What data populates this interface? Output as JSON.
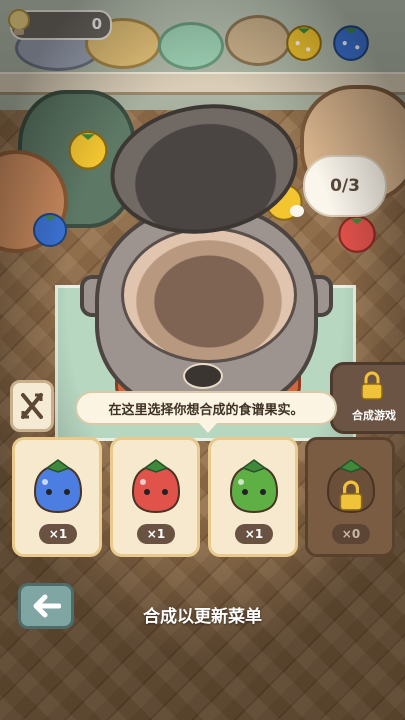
{
  "hud": {
    "coins": "0"
  },
  "recipe_progress": "0/3",
  "tooltip": "在这里选择你想合成的食谱果实。",
  "play_button": {
    "label": "合成游戏"
  },
  "cards": [
    {
      "fruit": "blue",
      "color": "#4c7de0",
      "quantity": "×1",
      "locked": false
    },
    {
      "fruit": "red",
      "color": "#e1524b",
      "quantity": "×1",
      "locked": false
    },
    {
      "fruit": "green",
      "color": "#5fb044",
      "quantity": "×1",
      "locked": false
    },
    {
      "fruit": "locked",
      "color": "#6b4f39",
      "quantity": "×0",
      "locked": true
    }
  ],
  "hint": "合成以更新菜单",
  "icons": {
    "coin": "lightbulb-coin-icon",
    "shuffle": "shuffle-icon",
    "lock": "lock-icon",
    "back": "back-arrow-icon"
  }
}
